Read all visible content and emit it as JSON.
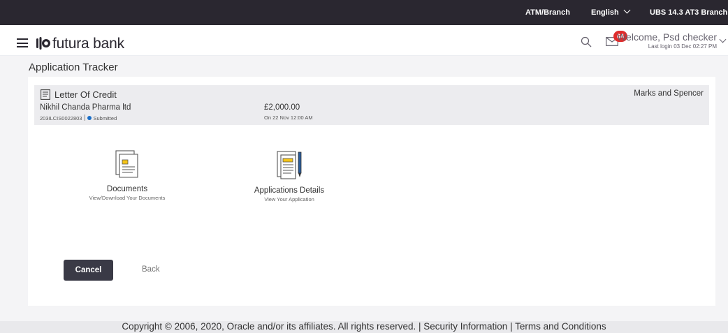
{
  "topbar": {
    "atm_branch": "ATM/Branch",
    "language": "English",
    "branch": "UBS 14.3 AT3 Branch"
  },
  "header": {
    "brand": "futura bank",
    "notification_count": "64",
    "welcome": "Welcome, Psd checker",
    "last_login": "Last login 03 Dec 02:27 PM"
  },
  "page": {
    "title": "Application Tracker"
  },
  "summary": {
    "product": "Letter Of Credit",
    "applicant": "Nikhil Chanda Pharma ltd",
    "reference": "203ILCIS0022803",
    "status": "Submitted",
    "amount": "£2,000.00",
    "date": "On 22 Nov 12:00 AM",
    "beneficiary": "Marks and Spencer"
  },
  "tiles": [
    {
      "title": "Documents",
      "subtitle": "View/Download Your Documents",
      "icon": "document-icon"
    },
    {
      "title": "Applications Details",
      "subtitle": "View Your Application",
      "icon": "application-details-icon"
    }
  ],
  "actions": {
    "cancel": "Cancel",
    "back": "Back"
  },
  "footer": {
    "text": "Copyright © 2006, 2020, Oracle and/or its affiliates. All rights reserved. | Security Information | Terms and Conditions"
  },
  "colors": {
    "topbar_bg": "#2a2730",
    "badge": "#e02c2c",
    "status_dot": "#1a6ec7",
    "button_bg": "#3a3a46",
    "icon_accent": "#f5c518"
  }
}
